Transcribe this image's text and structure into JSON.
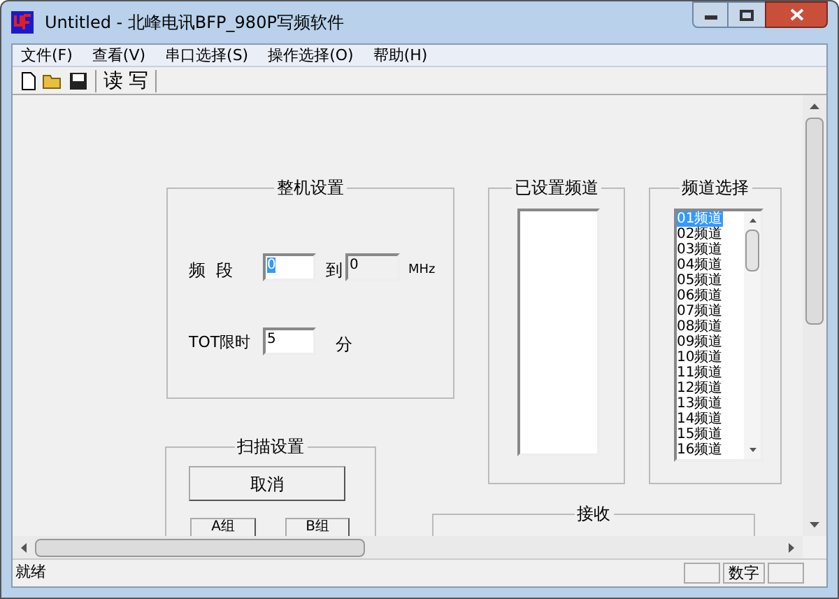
{
  "window": {
    "title": "Untitled - 北峰电讯BFP_980P写频软件"
  },
  "menu": [
    "文件(F)",
    "查看(V)",
    "串口选择(S)",
    "操作选择(O)",
    "帮助(H)"
  ],
  "toolbar": {
    "text_buttons": [
      "读",
      "写"
    ]
  },
  "machine_settings": {
    "title": "整机设置",
    "band_label": "频  段",
    "band_from": "0",
    "to_label": "到",
    "band_to": {
      "value": "0",
      "disabled": true
    },
    "unit": "MHz",
    "tot_label": "TOT限时",
    "tot_value": "5",
    "tot_unit": "分"
  },
  "set_channels": {
    "title": "已设置频道"
  },
  "channel_select": {
    "title": "频道选择",
    "items": [
      {
        "label": "01频道",
        "selected": true
      },
      {
        "label": "02频道",
        "selected": false
      },
      {
        "label": "03频道",
        "selected": false
      },
      {
        "label": "04频道",
        "selected": false
      },
      {
        "label": "05频道",
        "selected": false
      },
      {
        "label": "06频道",
        "selected": false
      },
      {
        "label": "07频道",
        "selected": false
      },
      {
        "label": "08频道",
        "selected": false
      },
      {
        "label": "09频道",
        "selected": false
      },
      {
        "label": "10频道",
        "selected": false
      },
      {
        "label": "11频道",
        "selected": false
      },
      {
        "label": "12频道",
        "selected": false
      },
      {
        "label": "13频道",
        "selected": false
      },
      {
        "label": "14频道",
        "selected": false
      },
      {
        "label": "15频道",
        "selected": false
      },
      {
        "label": "16频道",
        "selected": false
      }
    ]
  },
  "scan_settings": {
    "title": "扫描设置",
    "cancel": "取消",
    "group_a": "A组",
    "group_b": "B组"
  },
  "receive": {
    "title": "接收"
  },
  "status_bar": {
    "message": "就绪",
    "num": "数字"
  }
}
